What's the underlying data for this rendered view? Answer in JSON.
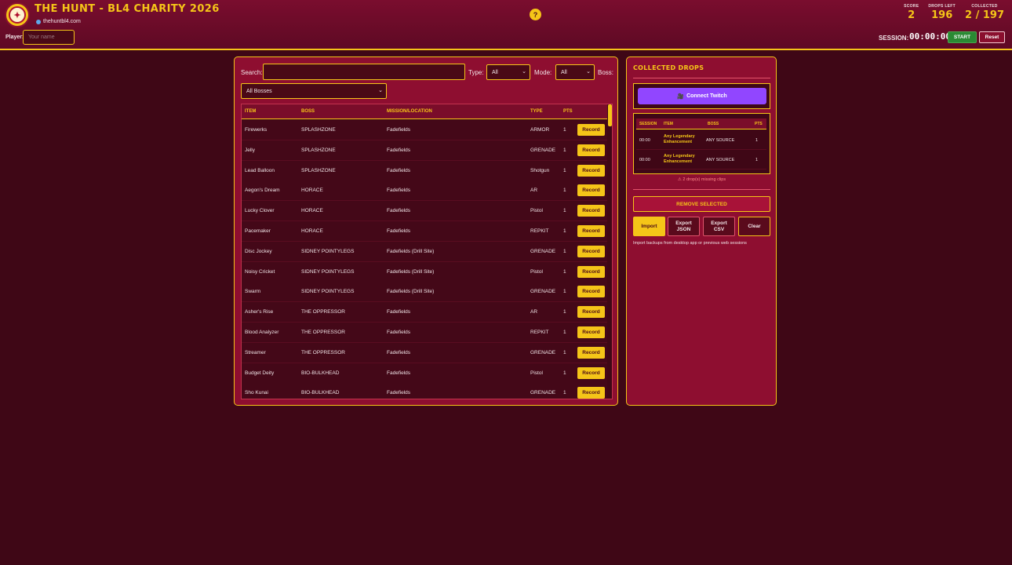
{
  "header": {
    "logo_icon": "crest-logo",
    "title": "THE HUNT - BL4 CHARITY 2026",
    "site": "thehuntbl4.com",
    "help": "?",
    "player_label": "Player:",
    "player_placeholder": "Your name",
    "stats": [
      {
        "label": "SCORE",
        "value": "2"
      },
      {
        "label": "DROPS LEFT",
        "value": "196"
      },
      {
        "label": "COLLECTED",
        "value": "2 / 197"
      }
    ],
    "session_label": "SESSION:",
    "session_time": "00:00:00",
    "start_label": "START",
    "reset_label": "Reset"
  },
  "filters": {
    "search_label": "Search:",
    "type_label": "Type:",
    "type_value": "All",
    "mode_label": "Mode:",
    "mode_value": "All",
    "boss_label": "Boss:",
    "boss_value": "All Bosses"
  },
  "table": {
    "headers": [
      "ITEM",
      "BOSS",
      "MISSION/LOCATION",
      "TYPE",
      "PTS"
    ],
    "record_label": "Record",
    "rows": [
      {
        "item": "Firewerks",
        "boss": "SPLASHZONE",
        "location": "Fadefields",
        "type": "ARMOR",
        "pts": "1"
      },
      {
        "item": "Jelly",
        "boss": "SPLASHZONE",
        "location": "Fadefields",
        "type": "GRENADE",
        "pts": "1"
      },
      {
        "item": "Lead Balloon",
        "boss": "SPLASHZONE",
        "location": "Fadefields",
        "type": "Shotgun",
        "pts": "1"
      },
      {
        "item": "Aegon's Dream",
        "boss": "HORACE",
        "location": "Fadefields",
        "type": "AR",
        "pts": "1"
      },
      {
        "item": "Lucky Clover",
        "boss": "HORACE",
        "location": "Fadefields",
        "type": "Pistol",
        "pts": "1"
      },
      {
        "item": "Pacemaker",
        "boss": "HORACE",
        "location": "Fadefields",
        "type": "REPKIT",
        "pts": "1"
      },
      {
        "item": "Disc Jockey",
        "boss": "SIDNEY POINTYLEGS",
        "location": "Fadefields (Drill Site)",
        "type": "GRENADE",
        "pts": "1"
      },
      {
        "item": "Noisy Cricket",
        "boss": "SIDNEY POINTYLEGS",
        "location": "Fadefields (Drill Site)",
        "type": "Pistol",
        "pts": "1"
      },
      {
        "item": "Swarm",
        "boss": "SIDNEY POINTYLEGS",
        "location": "Fadefields (Drill Site)",
        "type": "GRENADE",
        "pts": "1"
      },
      {
        "item": "Asher's Rise",
        "boss": "THE OPPRESSOR",
        "location": "Fadefields",
        "type": "AR",
        "pts": "1"
      },
      {
        "item": "Blood Analyzer",
        "boss": "THE OPPRESSOR",
        "location": "Fadefields",
        "type": "REPKIT",
        "pts": "1"
      },
      {
        "item": "Streamer",
        "boss": "THE OPPRESSOR",
        "location": "Fadefields",
        "type": "GRENADE",
        "pts": "1"
      },
      {
        "item": "Budget Deity",
        "boss": "BIO-BULKHEAD",
        "location": "Fadefields",
        "type": "Pistol",
        "pts": "1"
      },
      {
        "item": "Sho Kunai",
        "boss": "BIO-BULKHEAD",
        "location": "Fadefields",
        "type": "GRENADE",
        "pts": "1"
      }
    ]
  },
  "side": {
    "title": "COLLECTED DROPS",
    "twitch_label": "Connect Twitch",
    "twitch_icon": "camera-icon",
    "drops_headers": [
      "SESSION",
      "ITEM",
      "BOSS",
      "PTS"
    ],
    "drops": [
      {
        "session": "00:00",
        "item": "Any Legendary Enhancement",
        "item_line1": "Any Legendary",
        "item_line2": "Enhancement",
        "boss": "ANY SOURCE",
        "pts": "1"
      },
      {
        "session": "00:00",
        "item": "Any Legendary Enhancement",
        "item_line1": "Any Legendary",
        "item_line2": "Enhancement",
        "boss": "ANY SOURCE",
        "pts": "1"
      }
    ],
    "missing_note": "⚠ 2 drop(s) missing clips",
    "remove_label": "REMOVE SELECTED",
    "import_label": "Import",
    "export_json_line1": "Export",
    "export_json_line2": "JSON",
    "export_csv_line1": "Export",
    "export_csv_line2": "CSV",
    "clear_label": "Clear",
    "import_note": "Import backups from desktop app or previous web sessions"
  },
  "colors": {
    "accent": "#f5c518",
    "panel": "#8e0e30",
    "background": "#3f0716",
    "twitch": "#9146ff",
    "start": "#2a8a33"
  }
}
